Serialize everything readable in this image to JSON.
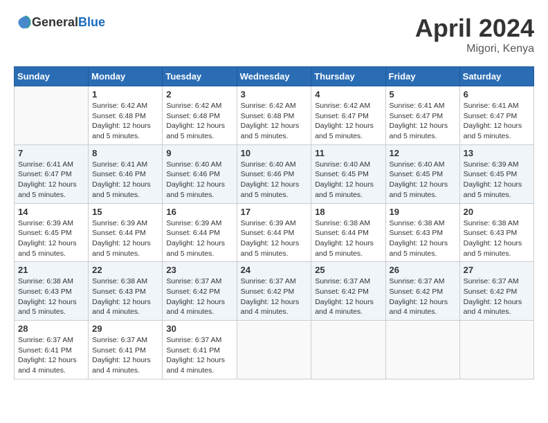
{
  "header": {
    "logo_general": "General",
    "logo_blue": "Blue",
    "title": "April 2024",
    "location": "Migori, Kenya"
  },
  "calendar": {
    "days_of_week": [
      "Sunday",
      "Monday",
      "Tuesday",
      "Wednesday",
      "Thursday",
      "Friday",
      "Saturday"
    ],
    "weeks": [
      [
        {
          "day": "",
          "info": ""
        },
        {
          "day": "1",
          "info": "Sunrise: 6:42 AM\nSunset: 6:48 PM\nDaylight: 12 hours\nand 5 minutes."
        },
        {
          "day": "2",
          "info": "Sunrise: 6:42 AM\nSunset: 6:48 PM\nDaylight: 12 hours\nand 5 minutes."
        },
        {
          "day": "3",
          "info": "Sunrise: 6:42 AM\nSunset: 6:48 PM\nDaylight: 12 hours\nand 5 minutes."
        },
        {
          "day": "4",
          "info": "Sunrise: 6:42 AM\nSunset: 6:47 PM\nDaylight: 12 hours\nand 5 minutes."
        },
        {
          "day": "5",
          "info": "Sunrise: 6:41 AM\nSunset: 6:47 PM\nDaylight: 12 hours\nand 5 minutes."
        },
        {
          "day": "6",
          "info": "Sunrise: 6:41 AM\nSunset: 6:47 PM\nDaylight: 12 hours\nand 5 minutes."
        }
      ],
      [
        {
          "day": "7",
          "info": "Sunrise: 6:41 AM\nSunset: 6:47 PM\nDaylight: 12 hours\nand 5 minutes."
        },
        {
          "day": "8",
          "info": "Sunrise: 6:41 AM\nSunset: 6:46 PM\nDaylight: 12 hours\nand 5 minutes."
        },
        {
          "day": "9",
          "info": "Sunrise: 6:40 AM\nSunset: 6:46 PM\nDaylight: 12 hours\nand 5 minutes."
        },
        {
          "day": "10",
          "info": "Sunrise: 6:40 AM\nSunset: 6:46 PM\nDaylight: 12 hours\nand 5 minutes."
        },
        {
          "day": "11",
          "info": "Sunrise: 6:40 AM\nSunset: 6:45 PM\nDaylight: 12 hours\nand 5 minutes."
        },
        {
          "day": "12",
          "info": "Sunrise: 6:40 AM\nSunset: 6:45 PM\nDaylight: 12 hours\nand 5 minutes."
        },
        {
          "day": "13",
          "info": "Sunrise: 6:39 AM\nSunset: 6:45 PM\nDaylight: 12 hours\nand 5 minutes."
        }
      ],
      [
        {
          "day": "14",
          "info": "Sunrise: 6:39 AM\nSunset: 6:45 PM\nDaylight: 12 hours\nand 5 minutes."
        },
        {
          "day": "15",
          "info": "Sunrise: 6:39 AM\nSunset: 6:44 PM\nDaylight: 12 hours\nand 5 minutes."
        },
        {
          "day": "16",
          "info": "Sunrise: 6:39 AM\nSunset: 6:44 PM\nDaylight: 12 hours\nand 5 minutes."
        },
        {
          "day": "17",
          "info": "Sunrise: 6:39 AM\nSunset: 6:44 PM\nDaylight: 12 hours\nand 5 minutes."
        },
        {
          "day": "18",
          "info": "Sunrise: 6:38 AM\nSunset: 6:44 PM\nDaylight: 12 hours\nand 5 minutes."
        },
        {
          "day": "19",
          "info": "Sunrise: 6:38 AM\nSunset: 6:43 PM\nDaylight: 12 hours\nand 5 minutes."
        },
        {
          "day": "20",
          "info": "Sunrise: 6:38 AM\nSunset: 6:43 PM\nDaylight: 12 hours\nand 5 minutes."
        }
      ],
      [
        {
          "day": "21",
          "info": "Sunrise: 6:38 AM\nSunset: 6:43 PM\nDaylight: 12 hours\nand 5 minutes."
        },
        {
          "day": "22",
          "info": "Sunrise: 6:38 AM\nSunset: 6:43 PM\nDaylight: 12 hours\nand 4 minutes."
        },
        {
          "day": "23",
          "info": "Sunrise: 6:37 AM\nSunset: 6:42 PM\nDaylight: 12 hours\nand 4 minutes."
        },
        {
          "day": "24",
          "info": "Sunrise: 6:37 AM\nSunset: 6:42 PM\nDaylight: 12 hours\nand 4 minutes."
        },
        {
          "day": "25",
          "info": "Sunrise: 6:37 AM\nSunset: 6:42 PM\nDaylight: 12 hours\nand 4 minutes."
        },
        {
          "day": "26",
          "info": "Sunrise: 6:37 AM\nSunset: 6:42 PM\nDaylight: 12 hours\nand 4 minutes."
        },
        {
          "day": "27",
          "info": "Sunrise: 6:37 AM\nSunset: 6:42 PM\nDaylight: 12 hours\nand 4 minutes."
        }
      ],
      [
        {
          "day": "28",
          "info": "Sunrise: 6:37 AM\nSunset: 6:41 PM\nDaylight: 12 hours\nand 4 minutes."
        },
        {
          "day": "29",
          "info": "Sunrise: 6:37 AM\nSunset: 6:41 PM\nDaylight: 12 hours\nand 4 minutes."
        },
        {
          "day": "30",
          "info": "Sunrise: 6:37 AM\nSunset: 6:41 PM\nDaylight: 12 hours\nand 4 minutes."
        },
        {
          "day": "",
          "info": ""
        },
        {
          "day": "",
          "info": ""
        },
        {
          "day": "",
          "info": ""
        },
        {
          "day": "",
          "info": ""
        }
      ]
    ]
  }
}
